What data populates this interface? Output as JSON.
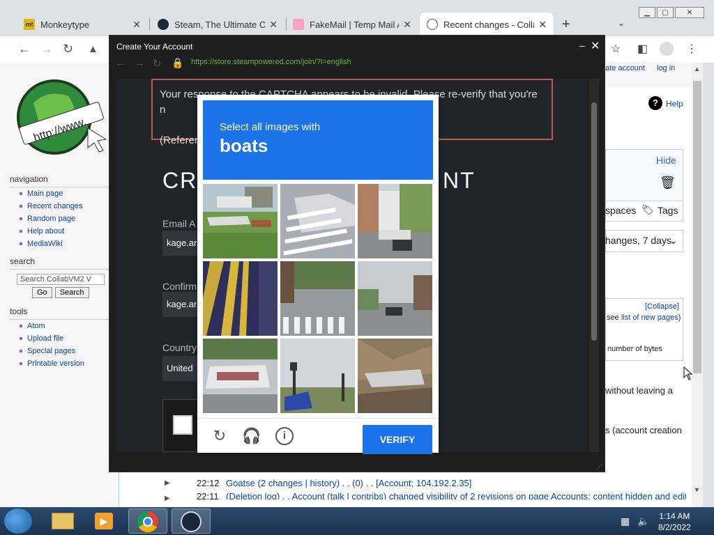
{
  "browser": {
    "tabs": [
      {
        "label": "Monkeytype",
        "fav": "mt"
      },
      {
        "label": "Steam, The Ultimate Onl",
        "fav": ""
      },
      {
        "label": "FakeMail | Temp Mail Ad",
        "fav": ""
      },
      {
        "label": "Recent changes - Collab",
        "fav": ""
      }
    ],
    "new_tab": "+",
    "tab_dropdown": "⌄"
  },
  "popup": {
    "title": "Create Your Account",
    "url": "https://store.steampowered.com/join/?l=english",
    "error_text": "Your response to the CAPTCHA appears to be invalid. Please re-verify that you're n",
    "error_line3": "(Referen",
    "heading_left": "CR",
    "heading_right": "NT",
    "email_label": "Email A",
    "email_value": "kage.ar",
    "confirm_label": "Confirm",
    "confirm_value": "kage.ar",
    "country_label": "Country",
    "country_value": "United"
  },
  "captcha": {
    "instruction": "Select all images with",
    "target": "boats",
    "verify_label": "VERIFY"
  },
  "wiki": {
    "sidebar": {
      "navigation_title": "navigation",
      "navigation_items": [
        "Main page",
        "Recent changes",
        "Random page",
        "Help about",
        "MediaWiki"
      ],
      "search_title": "search",
      "search_placeholder": "Search CollabVM2 V",
      "go_label": "Go",
      "search_label": "Search",
      "tools_title": "tools",
      "tools_items": [
        "Atom",
        "Upload file",
        "Special pages",
        "Printable version"
      ]
    },
    "right": {
      "create_account": "eate account",
      "log_in": "log in",
      "help": "Help",
      "hide": "Hide",
      "namespaces": "spaces",
      "tags": "Tags",
      "changes": "hanges, 7 days",
      "collapse": "[Collapse]",
      "see_new_pages_prefix": "see",
      "see_new_pages_link": "list of new pages",
      "see_new_pages_suffix": ")",
      "bytes": "number of bytes",
      "without": "without leaving a",
      "account_creation": "s (account creation"
    },
    "log": [
      {
        "time": "22:12",
        "text": "Goatse (2 changes | history) . . (0) . . [Account; 104.192.2.35]"
      },
      {
        "time": "22:11",
        "text": "(Deletion log) . . Account (talk | contribs) changed visibility of 2 revisions on page Accounts: content hidden and edit"
      }
    ]
  },
  "taskbar": {
    "time": "1:14 AM",
    "date": "8/2/2022"
  }
}
